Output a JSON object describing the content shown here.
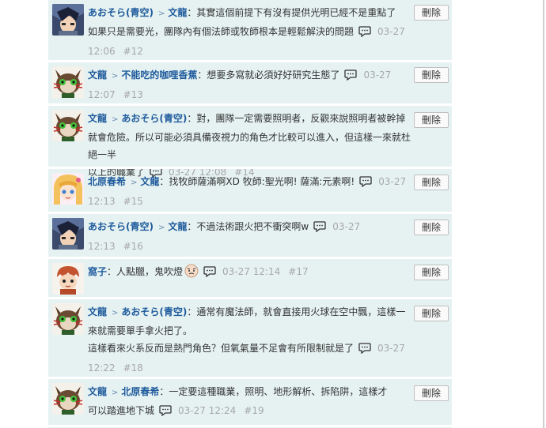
{
  "delete_label": "刪除",
  "arrow": ">",
  "comments": [
    {
      "user": "あおそら(青空)",
      "reply_to": "文龍",
      "text_line1": "：其實這個前提下有沒有提供光明已經不是重點了",
      "text_line2": "如果只是需要光，團隊內有個法師或牧師根本是輕鬆解決的問題",
      "date": "03-27",
      "time": "12:06",
      "num": "#12"
    },
    {
      "user": "文龍",
      "reply_to": "不能吃的咖哩香蕉",
      "text_line1": "：想要多寫就必須好好研究生態了",
      "date": "03-27",
      "time": "12:07",
      "num": "#13"
    },
    {
      "user": "文龍",
      "reply_to": "あおそら(青空)",
      "text_line1": "：對，團隊一定需要照明者，反觀來說照明者被幹掉",
      "text_line2": "就會危險。所以可能必須具備夜視力的角色才比較可以進入，但這樣一來就杜絕一半",
      "text_line3": "以上的職業了",
      "datetime": "03-27 12:08",
      "num": "#14"
    },
    {
      "user": "北原春希",
      "reply_to": "文龍",
      "text_line1": "：找牧師薩滿啊XD 牧師:聖光啊! 薩滿:元素啊!",
      "date": "03-27",
      "time": "12:13",
      "num": "#15"
    },
    {
      "user": "あおそら(青空)",
      "reply_to": "文龍",
      "text_line1": "：不過法術跟火把不衝突啊w",
      "date": "03-27",
      "time": "12:13",
      "num": "#16"
    },
    {
      "user": "窩子",
      "text_line1": "：人點臘，鬼吹燈",
      "datetime": "03-27 12:14",
      "num": "#17"
    },
    {
      "user": "文龍",
      "reply_to": "あおそら(青空)",
      "text_line1": "：通常有魔法師，就會直接用火球在空中飄，這樣一",
      "text_line2": "來就需要單手拿火把了。",
      "text_line3": "這樣看來火系反而是熱門角色？但氧氣量不足會有所限制就是了",
      "date": "03-27",
      "time": "12:22",
      "num": "#18"
    },
    {
      "user": "文龍",
      "reply_to": "北原春希",
      "text_line1": "：一定要這種職業，照明、地形解析、拆陷阱，這樣才",
      "text_line2": "可以踏進地下城",
      "datetime": "03-27 12:24",
      "num": "#19"
    }
  ],
  "colors": {
    "panel_bg": "#e6f2f2",
    "username": "#1f5b9c",
    "meta": "#a7a7a7"
  },
  "icons": {
    "reply": "speech-bubble-icon",
    "emoji": "sweat-face-emoji-icon"
  }
}
